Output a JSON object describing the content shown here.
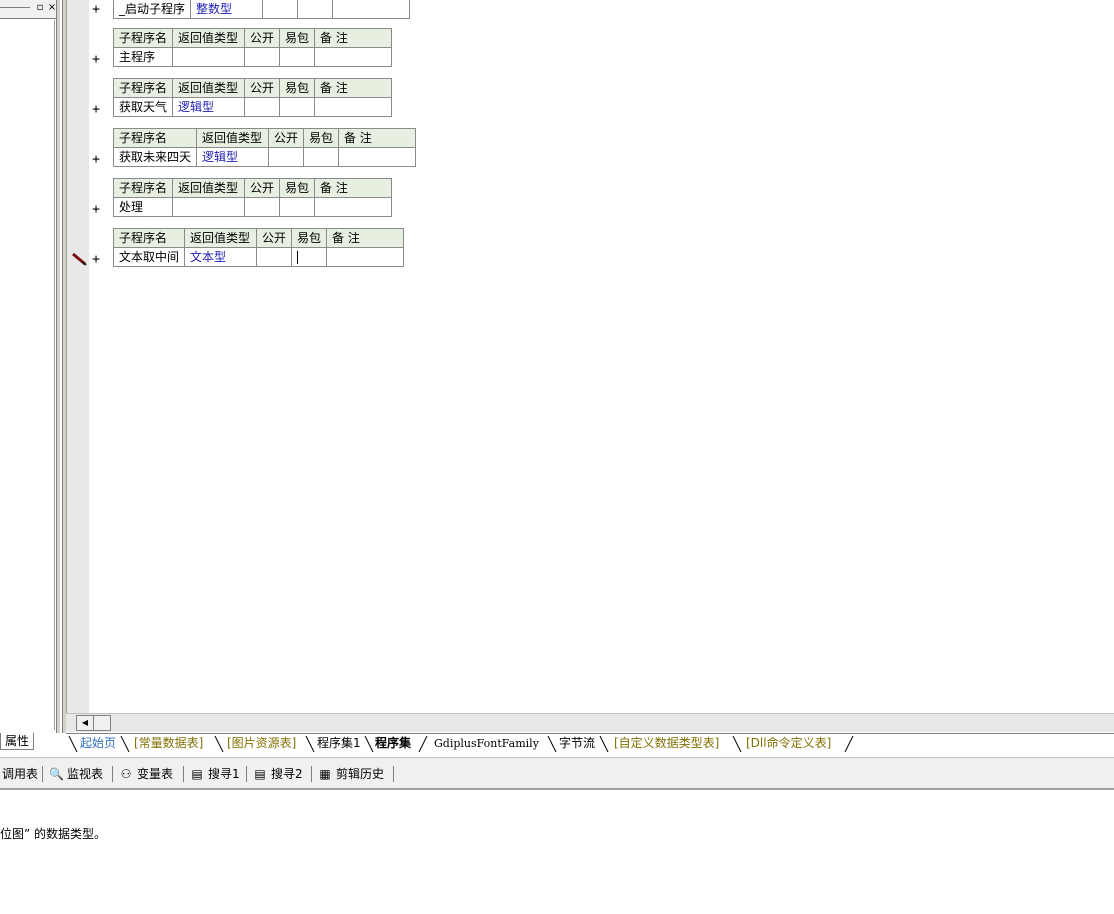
{
  "left_panel": {
    "max_btn": "▫",
    "close_btn": "×",
    "tab_label": "属性"
  },
  "table_headers": {
    "name": "子程序名",
    "ret": "返回值类型",
    "pub": "公开",
    "easy": "易包",
    "remark": "备 注"
  },
  "plus": "+",
  "subroutines": [
    {
      "name": "_启动子程序",
      "ret": "整数型",
      "partial": true
    },
    {
      "name": "主程序",
      "ret": ""
    },
    {
      "name": "获取天气",
      "ret": "逻辑型"
    },
    {
      "name": "获取未来四天",
      "ret": "逻辑型"
    },
    {
      "name": "处理",
      "ret": ""
    },
    {
      "name": "文本取中间",
      "ret": "文本型"
    }
  ],
  "doc_tabs": [
    {
      "label": "起始页"
    },
    {
      "label": "[常量数据表]"
    },
    {
      "label": "[图片资源表]"
    },
    {
      "label": "程序集1"
    },
    {
      "label": "程序集"
    },
    {
      "label": "GdiplusFontFamily"
    },
    {
      "label": "字节流"
    },
    {
      "label": "[自定义数据类型表]"
    },
    {
      "label": "[Dll命令定义表]"
    }
  ],
  "bottom_tabs": [
    {
      "label": "调用表",
      "icon": ""
    },
    {
      "label": "监视表",
      "icon": "🔍"
    },
    {
      "label": "变量表",
      "icon": "⚇"
    },
    {
      "label": "搜寻1",
      "icon": "▤"
    },
    {
      "label": "搜寻2",
      "icon": "▤"
    },
    {
      "label": "剪辑历史",
      "icon": "▦"
    }
  ],
  "output_text": "位图” 的数据类型。",
  "colors": {
    "header_bg": "#e6efe0",
    "type_blue": "#1e1eb4",
    "tab_olive": "#807000",
    "tab_start": "#3070c0"
  }
}
